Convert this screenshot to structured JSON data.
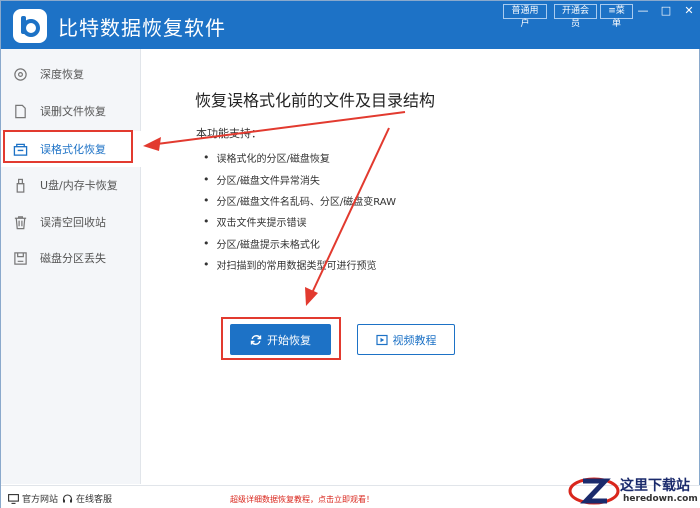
{
  "app": {
    "title": "比特数据恢复软件"
  },
  "header": {
    "user_type": "普通用户",
    "vip": "开通会员",
    "menu": "菜单"
  },
  "window_controls": {
    "minimize": "—",
    "maximize": "□",
    "close": "✕"
  },
  "sidebar": {
    "items": [
      {
        "label": "深度恢复",
        "icon": "deep-scan-icon"
      },
      {
        "label": "误删文件恢复",
        "icon": "file-icon"
      },
      {
        "label": "误格式化恢复",
        "icon": "format-icon"
      },
      {
        "label": "U盘/内存卡恢复",
        "icon": "usb-icon"
      },
      {
        "label": "误清空回收站",
        "icon": "recycle-bin-icon"
      },
      {
        "label": "磁盘分区丢失",
        "icon": "disk-icon"
      }
    ],
    "active_index": 2
  },
  "main": {
    "heading": "恢复误格式化前的文件及目录结构",
    "subtitle": "本功能支持：",
    "features": [
      "误格式化的分区/磁盘恢复",
      "分区/磁盘文件异常消失",
      "分区/磁盘文件名乱码、分区/磁盘变RAW",
      "双击文件夹提示错误",
      "分区/磁盘提示未格式化",
      "对扫描到的常用数据类型可进行预览"
    ],
    "start_button": "开始恢复",
    "video_button": "视频教程"
  },
  "footer": {
    "website": "官方网站",
    "support": "在线客服",
    "promo": "超级详细数据恢复教程，点击立即观看！"
  },
  "watermark": {
    "text": "这里下载站",
    "url": "heredown.com"
  },
  "colors": {
    "brand": "#1d72c6",
    "highlight": "#e23a2f",
    "sidebar_bg": "#f4f6f9"
  }
}
